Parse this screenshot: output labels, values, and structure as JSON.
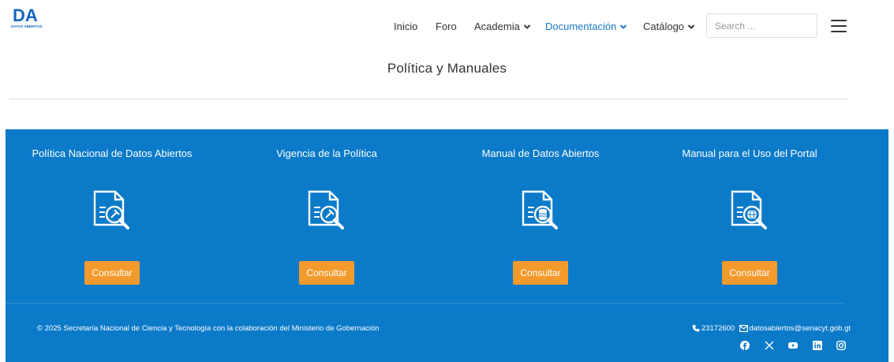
{
  "logo": {
    "text": "DA",
    "subtext": "DATOS ABIERTOS"
  },
  "nav": {
    "items": [
      {
        "label": "Inicio",
        "dropdown": false,
        "active": false
      },
      {
        "label": "Foro",
        "dropdown": false,
        "active": false
      },
      {
        "label": "Academia",
        "dropdown": true,
        "active": false
      },
      {
        "label": "Documentación",
        "dropdown": true,
        "active": true
      },
      {
        "label": "Catálogo",
        "dropdown": true,
        "active": false
      }
    ],
    "search_placeholder": "Search ...",
    "menu_icon": "hamburger-menu-icon"
  },
  "page": {
    "title": "Política y  Manuales"
  },
  "cards": [
    {
      "title": "Política Nacional de Datos Abiertos",
      "icon": "document-gavel-icon",
      "button": "Consultar"
    },
    {
      "title": "Vigencia de la Política",
      "icon": "document-gavel-icon",
      "button": "Consultar"
    },
    {
      "title": "Manual de Datos Abiertos",
      "icon": "document-database-icon",
      "button": "Consultar"
    },
    {
      "title": "Manual para el Uso del Portal",
      "icon": "document-globe-icon",
      "button": "Consultar"
    }
  ],
  "footer": {
    "copyright": "© 2025 Secretaría Nacional de Ciencia y Tecnología con la colaboración del Ministerio de Gobernación",
    "phone": "23172600",
    "email": "datosabiertos@senacyt.gob.gt",
    "socials": [
      "facebook-icon",
      "x-icon",
      "youtube-icon",
      "linkedin-icon",
      "instagram-icon"
    ]
  },
  "colors": {
    "primary_blue": "#0b7ac9",
    "accent_orange": "#f39a2c",
    "active_link": "#1a7ac9"
  }
}
